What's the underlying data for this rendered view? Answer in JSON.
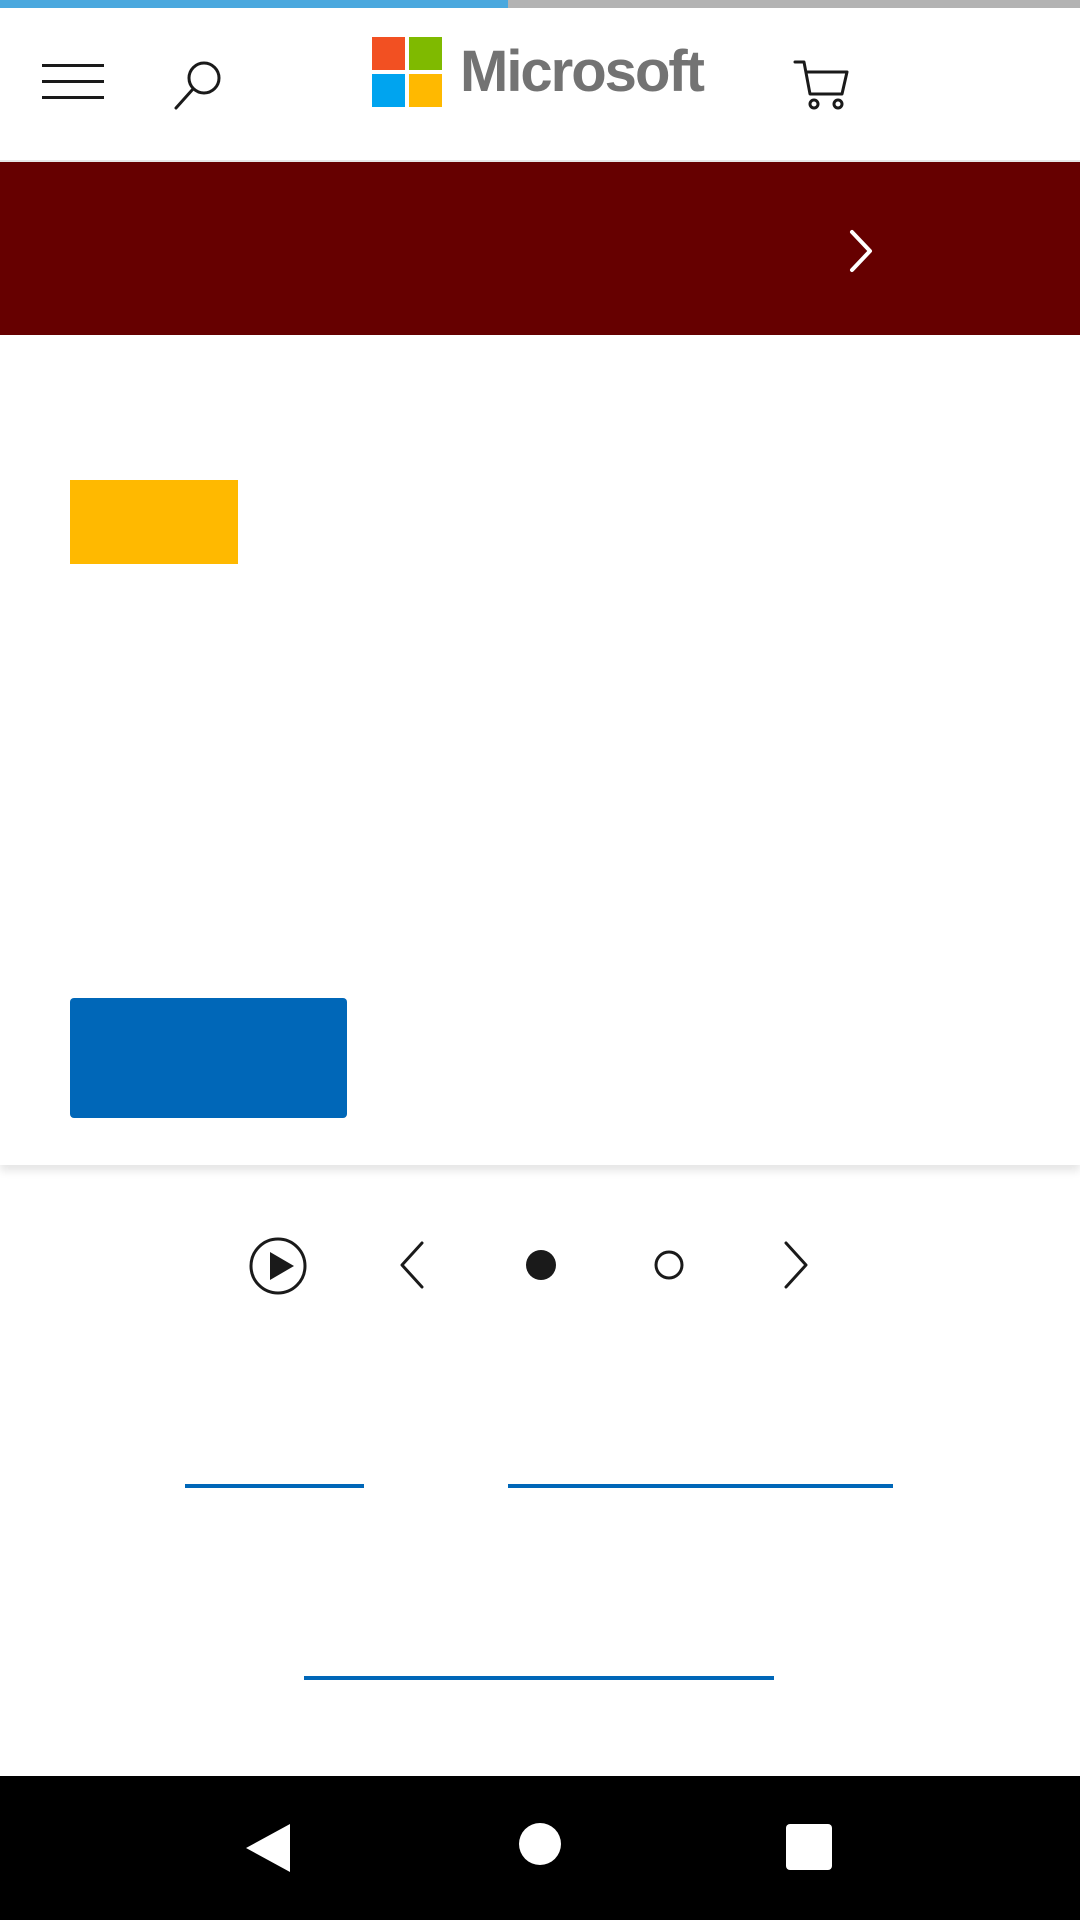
{
  "page_load_progress": 0.47,
  "header": {
    "menu_icon": "hamburger-menu-icon",
    "search_icon": "search-icon",
    "logo_text": "Microsoft",
    "logo_colors": [
      "#f25022",
      "#7fba00",
      "#00a4ef",
      "#ffb900"
    ],
    "cart_icon": "shopping-cart-icon"
  },
  "promo_banner": {
    "background": "#660000",
    "chevron_icon": "chevron-right-icon"
  },
  "hero": {
    "badge_color": "#ffb900",
    "cta_color": "#0067b8"
  },
  "carousel": {
    "play_icon": "play-circle-icon",
    "prev_icon": "chevron-left-icon",
    "next_icon": "chevron-right-icon",
    "slide_count": 2,
    "active_slide": 1
  },
  "link_color": "#0067b8",
  "system_nav": {
    "back_icon": "back-triangle-icon",
    "home_icon": "home-circle-icon",
    "recents_icon": "recents-square-icon"
  }
}
